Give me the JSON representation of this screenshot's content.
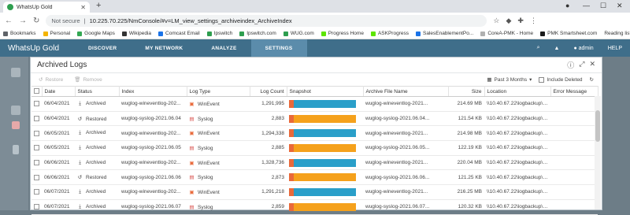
{
  "browser": {
    "tab_title": "WhatsUp Gold",
    "security": "Not secure",
    "url": "10.225.70.225/NmConsole/#v=LM_view_settings_archiveindex_ArchiveIndex",
    "bookmarks": [
      {
        "label": "Bookmarks",
        "color": "#5f6368"
      },
      {
        "label": "Personal",
        "color": "#f4b400"
      },
      {
        "label": "Google Maps",
        "color": "#34a853"
      },
      {
        "label": "Wikipedia",
        "color": "#333333"
      },
      {
        "label": "Comcast Email",
        "color": "#1a73e8"
      },
      {
        "label": "Ipswitch",
        "color": "#2e9e4f"
      },
      {
        "label": "Ipswitch.com",
        "color": "#2e9e4f"
      },
      {
        "label": "WUG.com",
        "color": "#2e9e4f"
      },
      {
        "label": "Progress Home",
        "color": "#5ce500"
      },
      {
        "label": "ASKProgress",
        "color": "#5ce500"
      },
      {
        "label": "SalesEnablementPo...",
        "color": "#1a73e8"
      },
      {
        "label": "CoreA-PMK - Home",
        "color": "#b0b0b0"
      },
      {
        "label": "PMK Smartsheet.com",
        "color": "#1a1a1a"
      }
    ],
    "reading_list": "Reading list"
  },
  "app": {
    "brand": "WhatsUp Gold",
    "menu": [
      "DISCOVER",
      "MY NETWORK",
      "ANALYZE",
      "SETTINGS"
    ],
    "active_menu": "SETTINGS",
    "user": "admin",
    "help": "HELP"
  },
  "dialog": {
    "title": "Archived Logs",
    "toolbar": {
      "restore": "Restore",
      "remove": "Remove",
      "range": "Past 3 Months",
      "include_deleted": "Include Deleted"
    },
    "columns": [
      "Date",
      "Status",
      "Index",
      "Log Type",
      "Log Count",
      "Snapshot",
      "Archive File Name",
      "Size",
      "Location",
      "Error Message"
    ],
    "rows": [
      {
        "date": "06/04/2021",
        "status": "Archived",
        "index": "wuglog-wineventlog-202...",
        "type": "WinEvent",
        "count": "1,291,995",
        "snap": "blue",
        "file": "wuglog-wineventlog-2021...",
        "size": "214.69 MB",
        "loc": "\\\\10.40.67.22\\logbackup\\1...",
        "err": ""
      },
      {
        "date": "06/04/2021",
        "status": "Restored",
        "index": "wuglog-syslog-2021.06.04",
        "type": "Syslog",
        "count": "2,883",
        "snap": "orange",
        "file": "wuglog-syslog-2021.06.04...",
        "size": "121.54 KB",
        "loc": "\\\\10.40.67.22\\logbackup\\1...",
        "err": ""
      },
      {
        "date": "06/05/2021",
        "status": "Archived",
        "index": "wuglog-wineventlog-202...",
        "type": "WinEvent",
        "count": "1,294,338",
        "snap": "blue",
        "file": "wuglog-wineventlog-2021...",
        "size": "214.98 MB",
        "loc": "\\\\10.40.67.22\\logbackup\\1...",
        "err": ""
      },
      {
        "date": "06/05/2021",
        "status": "Archived",
        "index": "wuglog-syslog-2021.06.05",
        "type": "Syslog",
        "count": "2,885",
        "snap": "orange",
        "file": "wuglog-syslog-2021.06.05...",
        "size": "122.19 KB",
        "loc": "\\\\10.40.67.22\\logbackup\\1...",
        "err": ""
      },
      {
        "date": "06/06/2021",
        "status": "Archived",
        "index": "wuglog-wineventlog-202...",
        "type": "WinEvent",
        "count": "1,328,736",
        "snap": "blue",
        "file": "wuglog-wineventlog-2021...",
        "size": "220.04 MB",
        "loc": "\\\\10.40.67.22\\logbackup\\1...",
        "err": ""
      },
      {
        "date": "06/06/2021",
        "status": "Restored",
        "index": "wuglog-syslog-2021.06.06",
        "type": "Syslog",
        "count": "2,873",
        "snap": "orange",
        "file": "wuglog-syslog-2021.06.06...",
        "size": "121.25 KB",
        "loc": "\\\\10.40.67.22\\logbackup\\1...",
        "err": ""
      },
      {
        "date": "06/07/2021",
        "status": "Archived",
        "index": "wuglog-wineventlog-202...",
        "type": "WinEvent",
        "count": "1,291,218",
        "snap": "blue",
        "file": "wuglog-wineventlog-2021...",
        "size": "216.25 MB",
        "loc": "\\\\10.40.67.22\\logbackup\\1...",
        "err": ""
      },
      {
        "date": "06/07/2021",
        "status": "Archived",
        "index": "wuglog-syslog-2021.06.07",
        "type": "Syslog",
        "count": "2,859",
        "snap": "orange",
        "file": "wuglog-syslog-2021.06.07...",
        "size": "120.32 KB",
        "loc": "\\\\10.40.67.22\\logbackup\\1...",
        "err": ""
      }
    ]
  },
  "colors": {
    "blue": "#2a9fc9",
    "orange": "#f5a11c",
    "accent": "#e9693a"
  }
}
